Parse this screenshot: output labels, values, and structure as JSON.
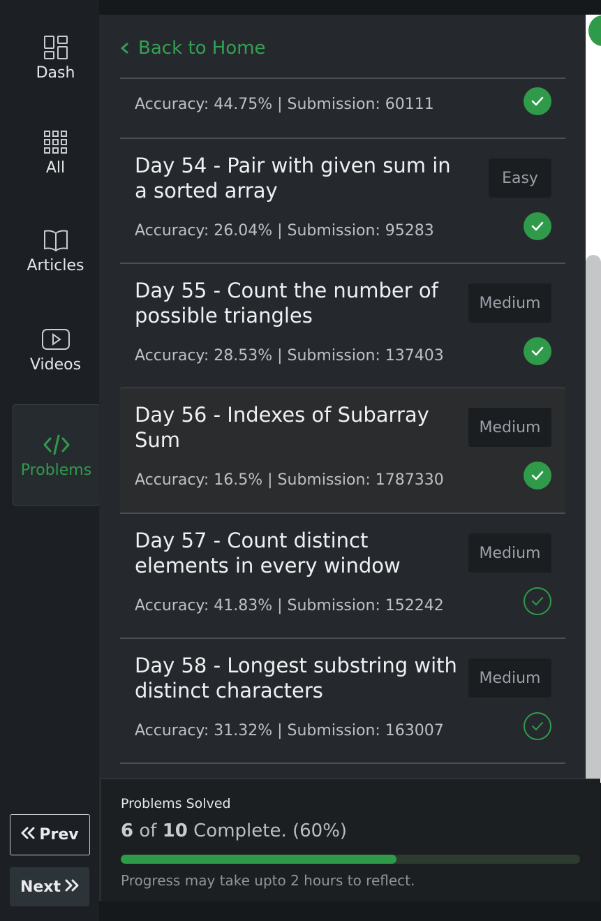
{
  "sidebar": {
    "items": [
      {
        "label": "Dash",
        "icon": "dashboard-icon"
      },
      {
        "label": "All",
        "icon": "grid-icon"
      },
      {
        "label": "Articles",
        "icon": "book-icon"
      },
      {
        "label": "Videos",
        "icon": "play-icon"
      },
      {
        "label": "Problems",
        "icon": "code-icon",
        "active": true
      }
    ],
    "prev_label": "Prev",
    "next_label": "Next"
  },
  "panel": {
    "back_label": "Back to Home",
    "problems": [
      {
        "title": "",
        "meta": "Accuracy: 44.75% | Submission: 60111",
        "difficulty": "",
        "solved": "filled"
      },
      {
        "title": "Day 54 - Pair with given sum in a sorted array",
        "meta": "Accuracy: 26.04% | Submission: 95283",
        "difficulty": "Easy",
        "solved": "filled"
      },
      {
        "title": "Day 55 - Count the number of possible triangles",
        "meta": "Accuracy: 28.53% | Submission: 137403",
        "difficulty": "Medium",
        "solved": "filled"
      },
      {
        "title": "Day 56 - Indexes of Subarray Sum",
        "meta": "Accuracy: 16.5% | Submission: 1787330",
        "difficulty": "Medium",
        "solved": "filled",
        "highlight": true
      },
      {
        "title": "Day 57 - Count distinct elements in every window",
        "meta": "Accuracy: 41.83% | Submission: 152242",
        "difficulty": "Medium",
        "solved": "outline"
      },
      {
        "title": "Day 58 - Longest substring with distinct characters",
        "meta": "Accuracy: 31.32% | Submission: 163007",
        "difficulty": "Medium",
        "solved": "outline"
      }
    ]
  },
  "progress": {
    "title": "Problems Solved",
    "solved": "6",
    "of_label": "of",
    "total": "10",
    "complete_label": "Complete. (60%)",
    "fraction": 0.6,
    "note": "Progress may take upto 2 hours to reflect."
  },
  "colors": {
    "accent": "#2f9b4a",
    "panel_bg": "#25292d",
    "sidebar_bg": "#1c2024"
  }
}
